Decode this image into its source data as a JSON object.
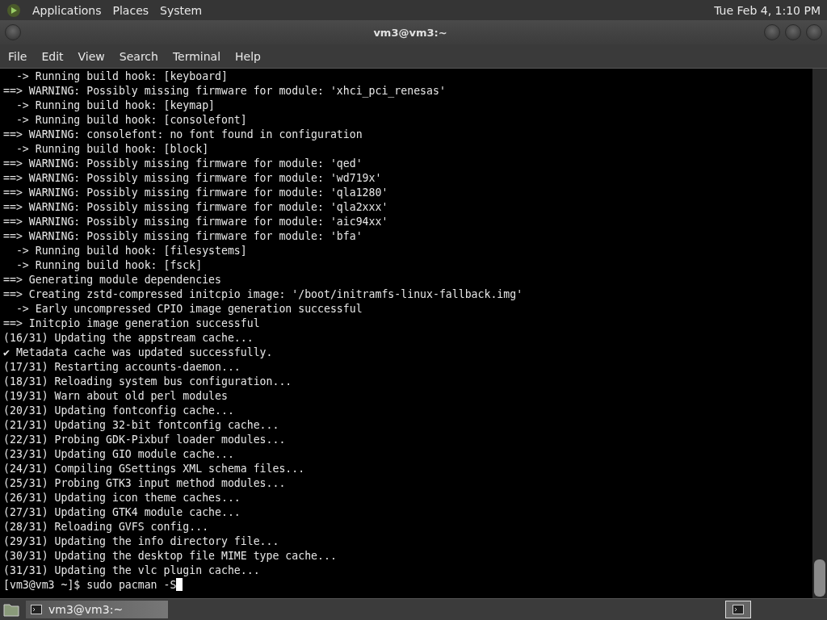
{
  "top_panel": {
    "menus": [
      "Applications",
      "Places",
      "System"
    ],
    "clock": "Tue Feb  4, 1:10 PM"
  },
  "window": {
    "title": "vm3@vm3:~"
  },
  "menu_bar": [
    "File",
    "Edit",
    "View",
    "Search",
    "Terminal",
    "Help"
  ],
  "terminal": {
    "lines": [
      "  -> Running build hook: [keyboard]",
      "==> WARNING: Possibly missing firmware for module: 'xhci_pci_renesas'",
      "  -> Running build hook: [keymap]",
      "  -> Running build hook: [consolefont]",
      "==> WARNING: consolefont: no font found in configuration",
      "  -> Running build hook: [block]",
      "==> WARNING: Possibly missing firmware for module: 'qed'",
      "==> WARNING: Possibly missing firmware for module: 'wd719x'",
      "==> WARNING: Possibly missing firmware for module: 'qla1280'",
      "==> WARNING: Possibly missing firmware for module: 'qla2xxx'",
      "==> WARNING: Possibly missing firmware for module: 'aic94xx'",
      "==> WARNING: Possibly missing firmware for module: 'bfa'",
      "  -> Running build hook: [filesystems]",
      "  -> Running build hook: [fsck]",
      "==> Generating module dependencies",
      "==> Creating zstd-compressed initcpio image: '/boot/initramfs-linux-fallback.img'",
      "  -> Early uncompressed CPIO image generation successful",
      "==> Initcpio image generation successful",
      "(16/31) Updating the appstream cache...",
      "✔ Metadata cache was updated successfully.",
      "(17/31) Restarting accounts-daemon...",
      "(18/31) Reloading system bus configuration...",
      "(19/31) Warn about old perl modules",
      "(20/31) Updating fontconfig cache...",
      "(21/31) Updating 32-bit fontconfig cache...",
      "(22/31) Probing GDK-Pixbuf loader modules...",
      "(23/31) Updating GIO module cache...",
      "(24/31) Compiling GSettings XML schema files...",
      "(25/31) Probing GTK3 input method modules...",
      "(26/31) Updating icon theme caches...",
      "(27/31) Updating GTK4 module cache...",
      "(28/31) Reloading GVFS config...",
      "(29/31) Updating the info directory file...",
      "(30/31) Updating the desktop file MIME type cache...",
      "(31/31) Updating the vlc plugin cache..."
    ],
    "prompt": "[vm3@vm3 ~]$ sudo pacman -S"
  },
  "taskbar": {
    "tasks": [
      {
        "label": "vm3@vm3:~",
        "selected": true
      }
    ]
  }
}
